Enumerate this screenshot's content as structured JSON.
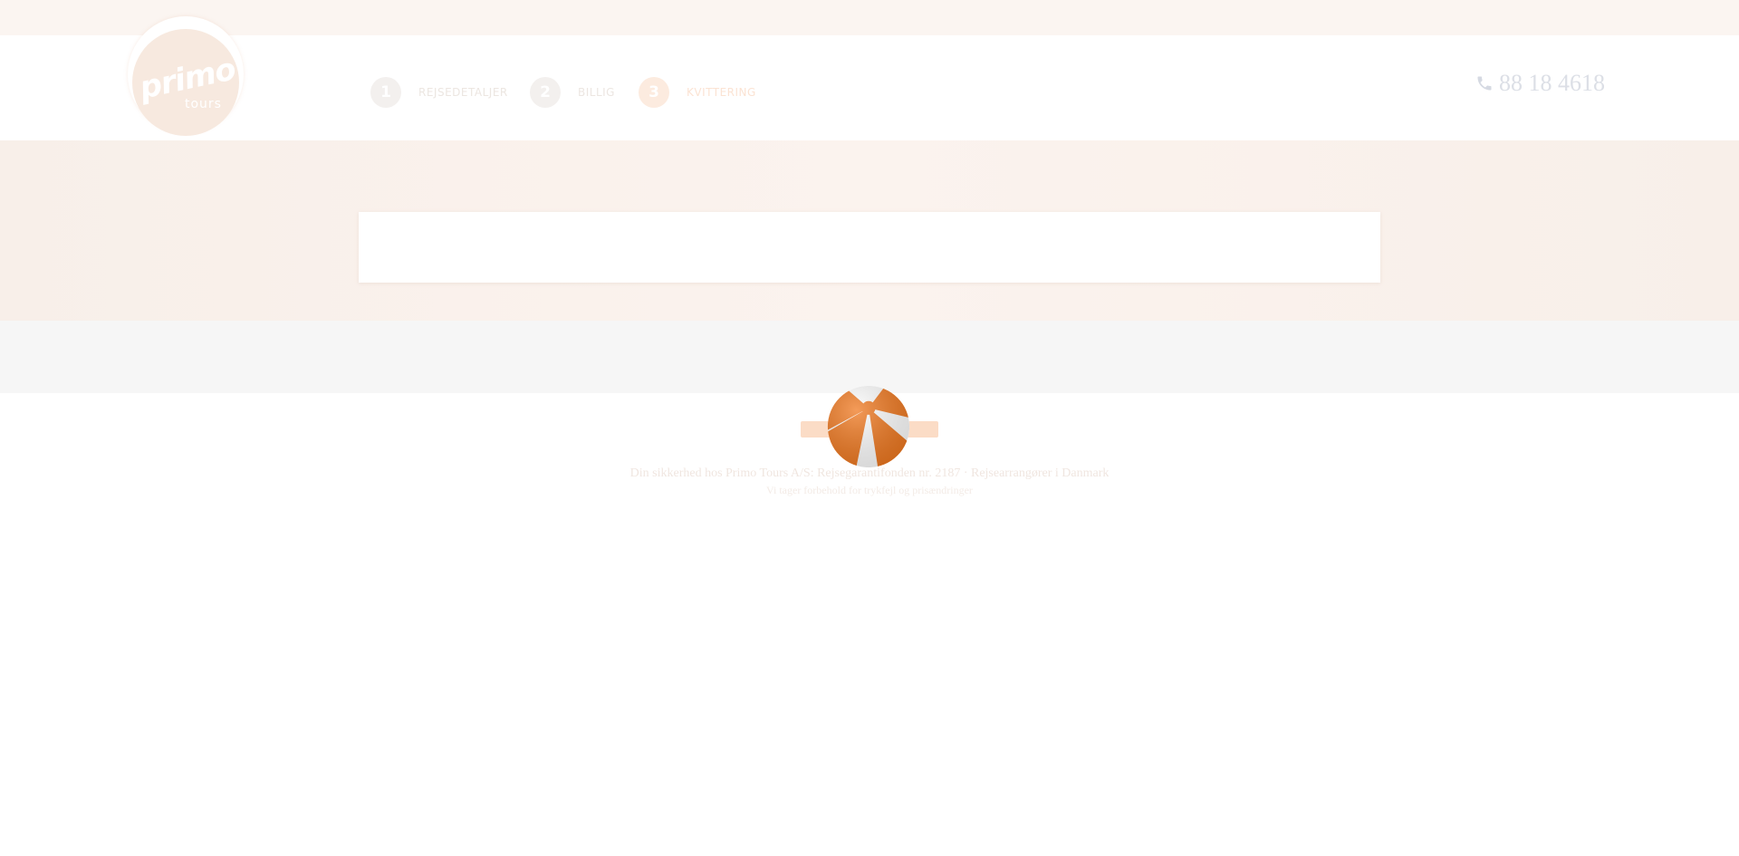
{
  "brand": {
    "logo_primary": "primo",
    "logo_secondary": "tours",
    "accent_color": "#f07a22"
  },
  "steps": [
    {
      "number": "1",
      "label": "REJSEDETALJER",
      "active": false
    },
    {
      "number": "2",
      "label": "BILLIG",
      "active": false
    },
    {
      "number": "3",
      "label": "KVITTERING",
      "active": true
    }
  ],
  "contact": {
    "phone": "88 18 4618",
    "icon": "phone-icon"
  },
  "footer": {
    "line1": "Din sikkerhed hos Primo Tours A/S: Rejsegarantifonden nr. 2187 · Rejsearrangører i Danmark",
    "line2": "Vi tager forbehold for trykfejl og prisændringer"
  },
  "loader": {
    "icon": "beach-ball-icon"
  }
}
